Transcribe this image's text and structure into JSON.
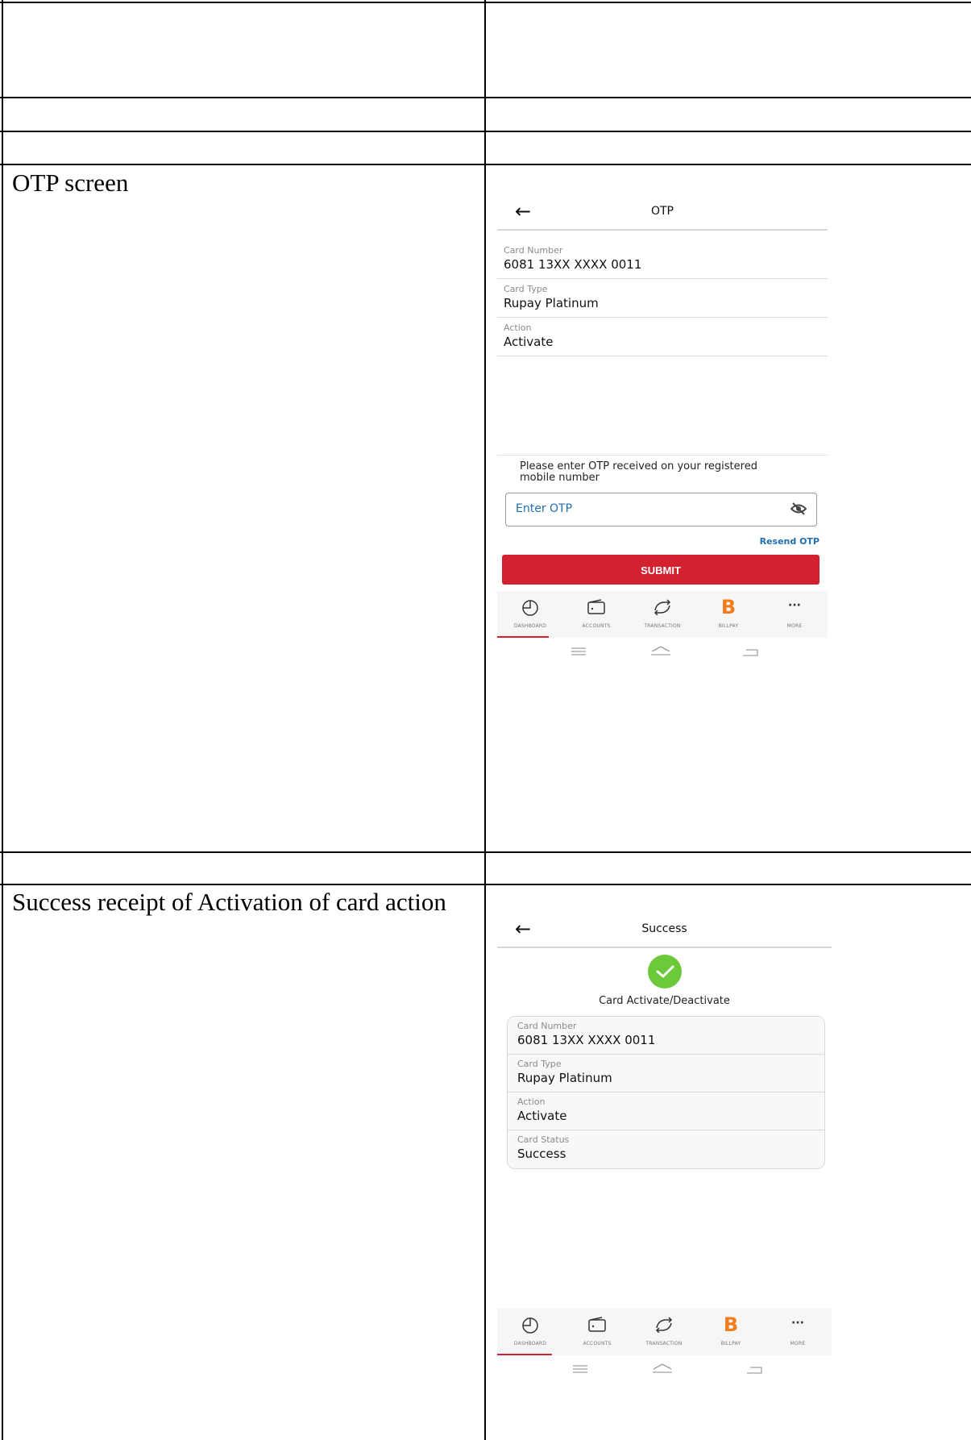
{
  "document": {
    "rows": [
      {
        "label": "OTP screen"
      },
      {
        "label": "Success receipt of Activation of card action"
      }
    ]
  },
  "otp_screen": {
    "title": "OTP",
    "fields": [
      {
        "label": "Card Number",
        "value": "6081 13XX XXXX 0011"
      },
      {
        "label": "Card Type",
        "value": "Rupay Platinum"
      },
      {
        "label": "Action",
        "value": "Activate"
      }
    ],
    "prompt": "Please enter OTP received on your registered mobile number",
    "otp_placeholder": "Enter OTP",
    "resend_label": "Resend OTP",
    "submit_label": "SUBMIT"
  },
  "success_screen": {
    "title": "Success",
    "subtitle": "Card Activate/Deactivate",
    "fields": [
      {
        "label": "Card Number",
        "value": "6081 13XX XXXX 0011"
      },
      {
        "label": "Card Type",
        "value": "Rupay Platinum"
      },
      {
        "label": "Action",
        "value": "Activate"
      },
      {
        "label": "Card Status",
        "value": "Success"
      }
    ]
  },
  "bottom_nav": {
    "items": [
      {
        "label": "DASHBOARD",
        "icon": "dashboard-icon"
      },
      {
        "label": "ACCOUNTS",
        "icon": "wallet-icon"
      },
      {
        "label": "TRANSACTION",
        "icon": "transaction-icon"
      },
      {
        "label": "BILLPAY",
        "icon": "billpay-icon"
      },
      {
        "label": "MORE",
        "icon": "more-icon"
      }
    ]
  },
  "colors": {
    "accent": "#d42130",
    "link": "#1f6fb3",
    "success": "#6bc93a",
    "billpay": "#f07c1c"
  }
}
